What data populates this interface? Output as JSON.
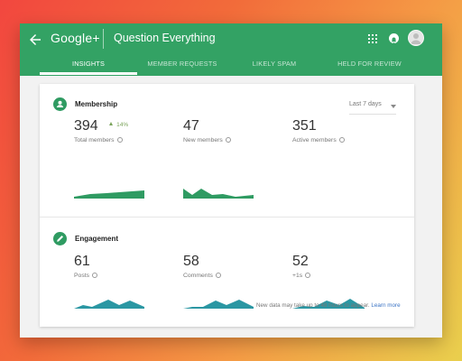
{
  "appbar": {
    "brand": "Google+",
    "title": "Question Everything",
    "tabs": [
      "INSIGHTS",
      "MEMBER REQUESTS",
      "LIKELY SPAM",
      "HELD FOR REVIEW"
    ]
  },
  "membership": {
    "title": "Membership",
    "range": "Last 7 days",
    "metrics": [
      {
        "value": "394",
        "label": "Total members",
        "delta": "14%"
      },
      {
        "value": "47",
        "label": "New members"
      },
      {
        "value": "351",
        "label": "Active members"
      }
    ]
  },
  "engagement": {
    "title": "Engagement",
    "metrics": [
      {
        "value": "61",
        "label": "Posts"
      },
      {
        "value": "58",
        "label": "Comments"
      },
      {
        "value": "52",
        "label": "+1s"
      }
    ]
  },
  "footer": {
    "note": "New data may take up to 48 hours to appear.",
    "link": "Learn more"
  },
  "colors": {
    "appbar": "#33a264",
    "membership_chart": "#2f9b62",
    "engagement_chart": "#2b97a3"
  }
}
